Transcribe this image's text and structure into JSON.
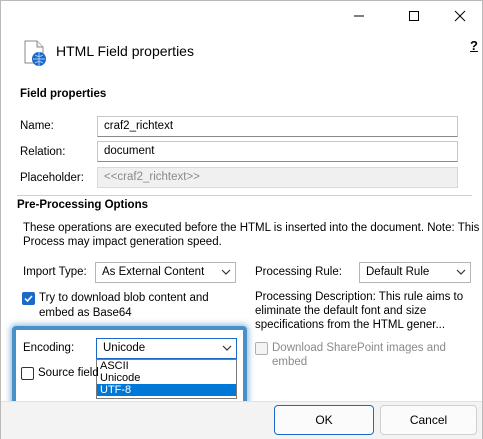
{
  "dialog": {
    "title": "HTML Field properties",
    "help": "?"
  },
  "field_properties": {
    "heading": "Field properties",
    "name_label": "Name:",
    "name_value": "craf2_richtext",
    "relation_label": "Relation:",
    "relation_value": "document",
    "placeholder_label": "Placeholder:",
    "placeholder_value": "<<craf2_richtext>>"
  },
  "pre_processing": {
    "heading": "Pre-Processing Options",
    "description_line1": "These operations are executed before the HTML is inserted into the document. Note: This",
    "description_line2": "Process may impact generation speed.",
    "import_type_label": "Import Type:",
    "import_type_value": "As External Content",
    "processing_rule_label": "Processing Rule:",
    "processing_rule_value": "Default Rule",
    "try_download_line1": "Try to download blob content and",
    "try_download_line2": "embed as Base64",
    "try_download_checked": true,
    "processing_description_line1": "Processing Description: This rule aims to",
    "processing_description_line2": "eliminate the default font and size",
    "processing_description_line3": "specifications from the HTML gener...",
    "encoding_label": "Encoding:",
    "encoding_value": "Unicode",
    "encoding_options": [
      "ASCII",
      "Unicode",
      "UTF-8"
    ],
    "encoding_highlighted": "UTF-8",
    "source_field_label": "Source field",
    "download_sharepoint_line1": "Download SharePoint images and",
    "download_sharepoint_line2": "embed"
  },
  "buttons": {
    "ok": "OK",
    "cancel": "Cancel"
  },
  "colors": {
    "accent": "#1b6ac9",
    "selection": "#0078d7",
    "highlight_border": "#4a90c8"
  }
}
